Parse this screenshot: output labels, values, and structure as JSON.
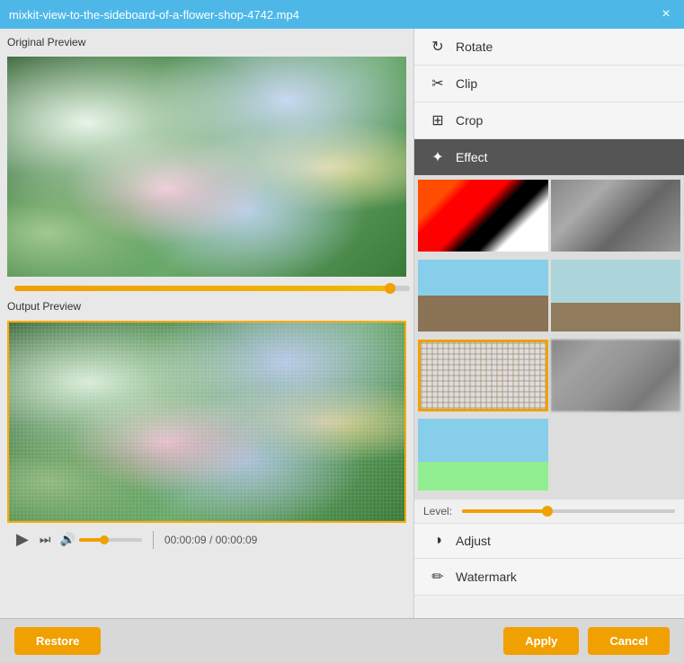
{
  "titleBar": {
    "title": "mixkit-view-to-the-sideboard-of-a-flower-shop-4742.mp4",
    "closeIcon": "×"
  },
  "leftPanel": {
    "originalLabel": "Original Preview",
    "outputLabel": "Output Preview"
  },
  "playback": {
    "currentTime": "00:00:09",
    "totalTime": "00:00:09"
  },
  "rightPanel": {
    "menuItems": [
      {
        "id": "rotate",
        "label": "Rotate",
        "icon": "↻"
      },
      {
        "id": "clip",
        "label": "Clip",
        "icon": "✂"
      },
      {
        "id": "crop",
        "label": "Crop",
        "icon": "⊞"
      },
      {
        "id": "effect",
        "label": "Effect",
        "icon": "✦",
        "active": true
      }
    ],
    "effectThumbs": [
      {
        "id": "neon",
        "style": "neon"
      },
      {
        "id": "sketch",
        "style": "sketch"
      },
      {
        "id": "person1",
        "style": "person1"
      },
      {
        "id": "person2",
        "style": "person2"
      },
      {
        "id": "stitch",
        "style": "stitch",
        "selected": true
      },
      {
        "id": "blur",
        "style": "blur"
      },
      {
        "id": "person3",
        "style": "person3"
      }
    ],
    "levelLabel": "Level:",
    "bottomMenu": [
      {
        "id": "adjust",
        "label": "Adjust",
        "icon": "◑"
      },
      {
        "id": "watermark",
        "label": "Watermark",
        "icon": "✏"
      }
    ]
  },
  "bottomBar": {
    "restoreLabel": "Restore",
    "applyLabel": "Apply",
    "cancelLabel": "Cancel"
  }
}
